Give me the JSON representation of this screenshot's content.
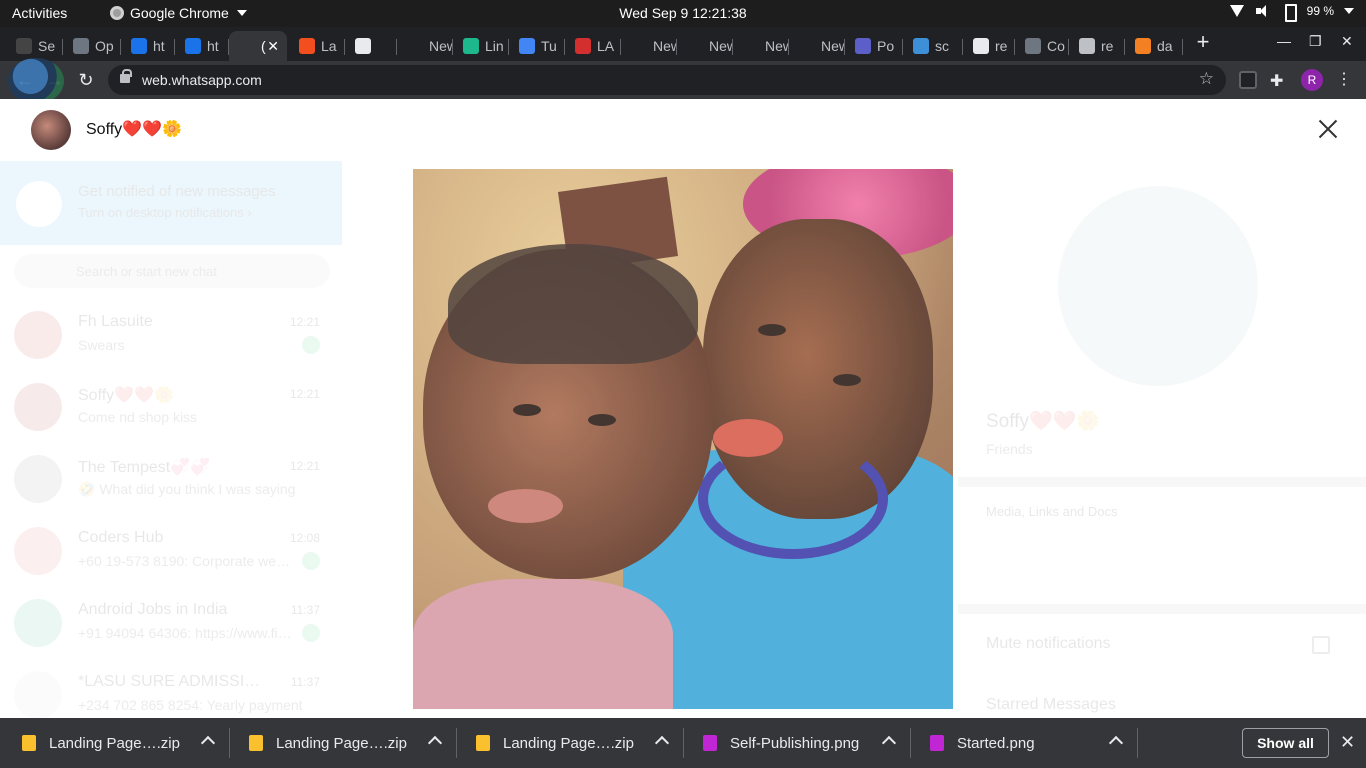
{
  "topbar": {
    "activities": "Activities",
    "app_name": "Google Chrome",
    "clock": "Wed Sep 9  12:21:38",
    "battery": "99 %"
  },
  "tabs": [
    {
      "label": "Se",
      "fav_color": "#444444"
    },
    {
      "label": "Op",
      "fav_color": "#6e7681"
    },
    {
      "label": "ht",
      "fav_color": "#1a73e8"
    },
    {
      "label": "ht",
      "fav_color": "#1a73e8"
    },
    {
      "label": "(",
      "fav_color": "#35363a"
    },
    {
      "label": "La",
      "fav_color": "#f24e1e"
    },
    {
      "label": "",
      "fav_color": "#e8eaed"
    },
    {
      "label": "New T",
      "fav_color": "#202124"
    },
    {
      "label": "Lin",
      "fav_color": "#1db98d"
    },
    {
      "label": "Tu",
      "fav_color": "#4285f4"
    },
    {
      "label": "LA",
      "fav_color": "#d32f2f"
    },
    {
      "label": "New T",
      "fav_color": "#202124"
    },
    {
      "label": "New T",
      "fav_color": "#202124"
    },
    {
      "label": "New T",
      "fav_color": "#202124"
    },
    {
      "label": "New T",
      "fav_color": "#202124"
    },
    {
      "label": "Po",
      "fav_color": "#5b5fc7"
    },
    {
      "label": "sc",
      "fav_color": "#3d8fd8"
    },
    {
      "label": "re",
      "fav_color": "#e8eaed"
    },
    {
      "label": "Co",
      "fav_color": "#6e7681"
    },
    {
      "label": "re",
      "fav_color": "#bdc1c6"
    },
    {
      "label": "da",
      "fav_color": "#f48024"
    }
  ],
  "toolbar": {
    "url": "web.whatsapp.com",
    "profile_initial": "R"
  },
  "viewer": {
    "contact_name": "Soffy❤️❤️🌼"
  },
  "background": {
    "notification_title": "Get notified of new messages",
    "notification_sub": "Turn on desktop notifications ›",
    "search_placeholder": "Search or start new chat",
    "chats": [
      {
        "name": "Fh Lasuite",
        "time": "12:21",
        "message": "Swears",
        "badge": true
      },
      {
        "name": "Soffy❤️❤️🌼",
        "time": "12:21",
        "message": "Come nd shop kiss",
        "badge": false
      },
      {
        "name": "The Tempest💞💞",
        "time": "12:21",
        "message": "🤣 What did you think I was saying",
        "badge": false
      },
      {
        "name": "Coders Hub",
        "time": "12:08",
        "message": "+60 19-573 8190: Corporate we…",
        "badge": true
      },
      {
        "name": "Android Jobs in India",
        "time": "11:37",
        "message": "+91 94094 64306: https://www.fi…",
        "badge": true
      },
      {
        "name": "*LASU SURE ADMISSI…",
        "time": "11:37",
        "message": "+234 702 865 8254: Yearly payment",
        "badge": false
      }
    ],
    "profile_name": "Soffy❤️❤️🌼",
    "profile_sub": "Friends",
    "media_label": "Media, Links and Docs",
    "mute_label": "Mute notifications",
    "starred_label": "Starred Messages"
  },
  "downloads": {
    "items": [
      {
        "name": "Landing Page….zip",
        "icon_color": "#fbc02d"
      },
      {
        "name": "Landing Page….zip",
        "icon_color": "#fbc02d"
      },
      {
        "name": "Landing Page….zip",
        "icon_color": "#fbc02d"
      },
      {
        "name": "Self-Publishing.png",
        "icon_color": "#c026d3"
      },
      {
        "name": "Started.png",
        "icon_color": "#c026d3"
      }
    ],
    "show_all": "Show all"
  }
}
